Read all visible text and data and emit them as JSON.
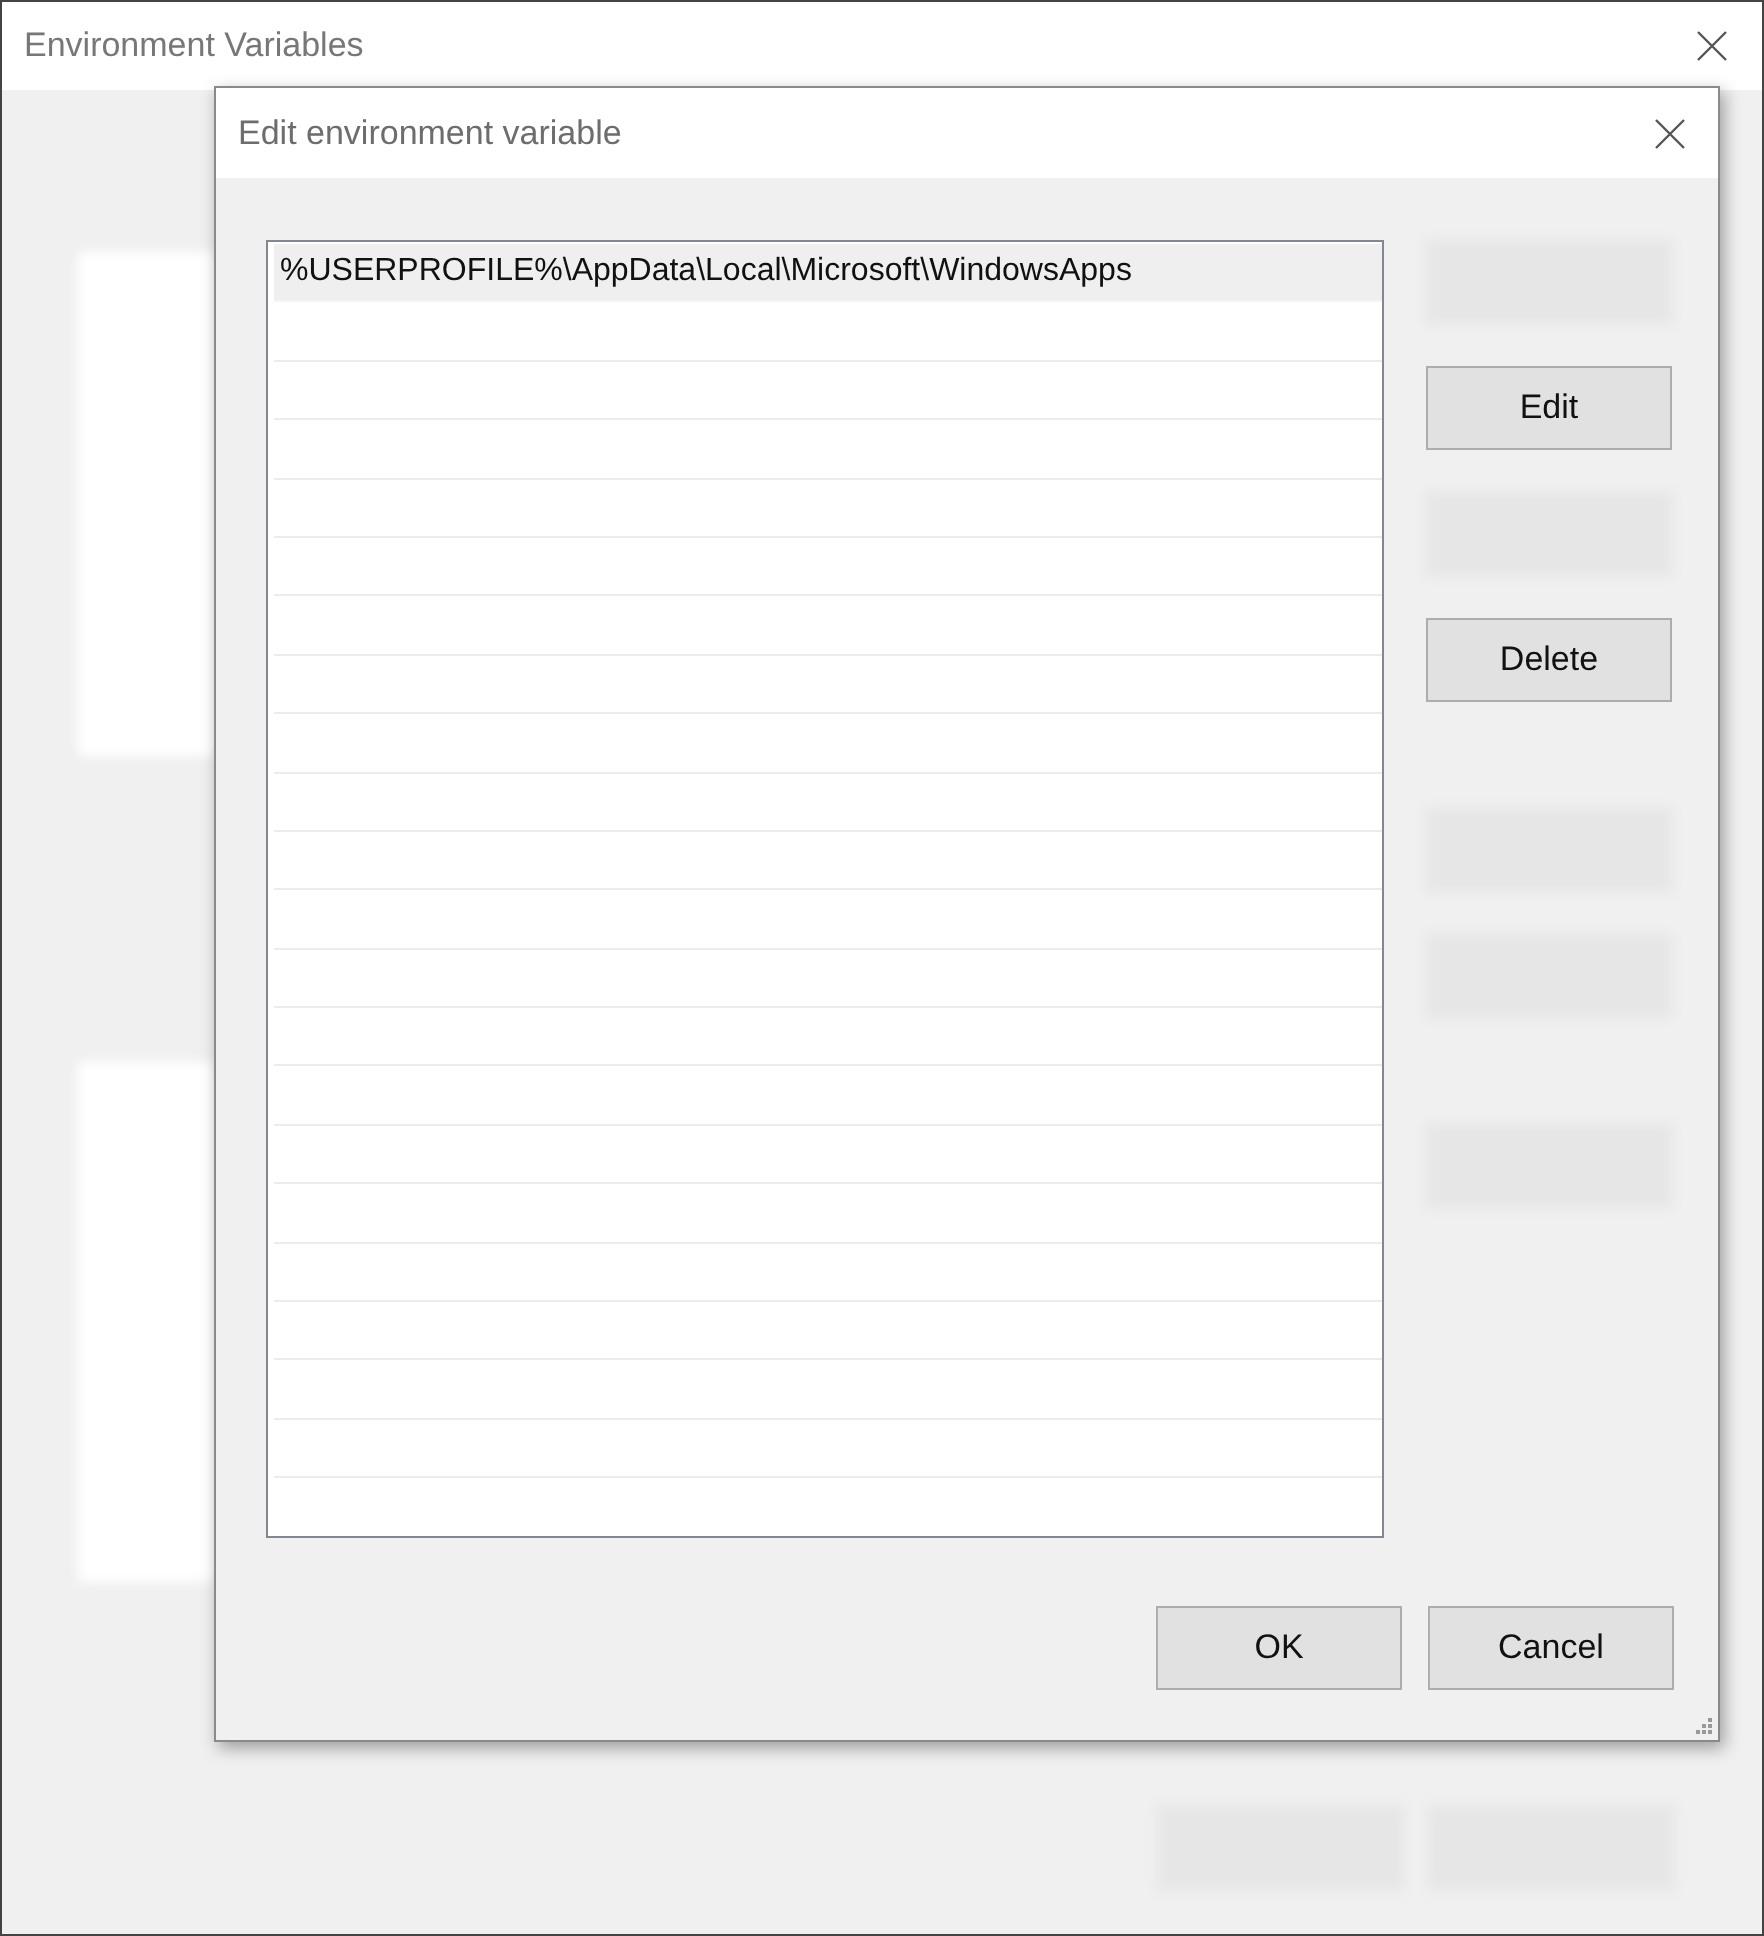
{
  "window": {
    "title": "Environment Variables"
  },
  "background_buttons": [
    {
      "disabled": true
    },
    {
      "disabled": true
    }
  ],
  "dialog": {
    "title": "Edit environment variable",
    "entries": [
      {
        "text": "%USERPROFILE%\\AppData\\Local\\Microsoft\\WindowsApps",
        "selected": true
      }
    ],
    "side_buttons": [
      {
        "disabled": true
      },
      {
        "label": "Edit",
        "disabled": false
      },
      {
        "disabled": true
      },
      {
        "label": "Delete",
        "disabled": false
      },
      {
        "disabled": true
      },
      {
        "disabled": true
      },
      {
        "disabled": true
      }
    ],
    "buttons": [
      {
        "label": "OK"
      },
      {
        "label": "Cancel"
      }
    ]
  }
}
